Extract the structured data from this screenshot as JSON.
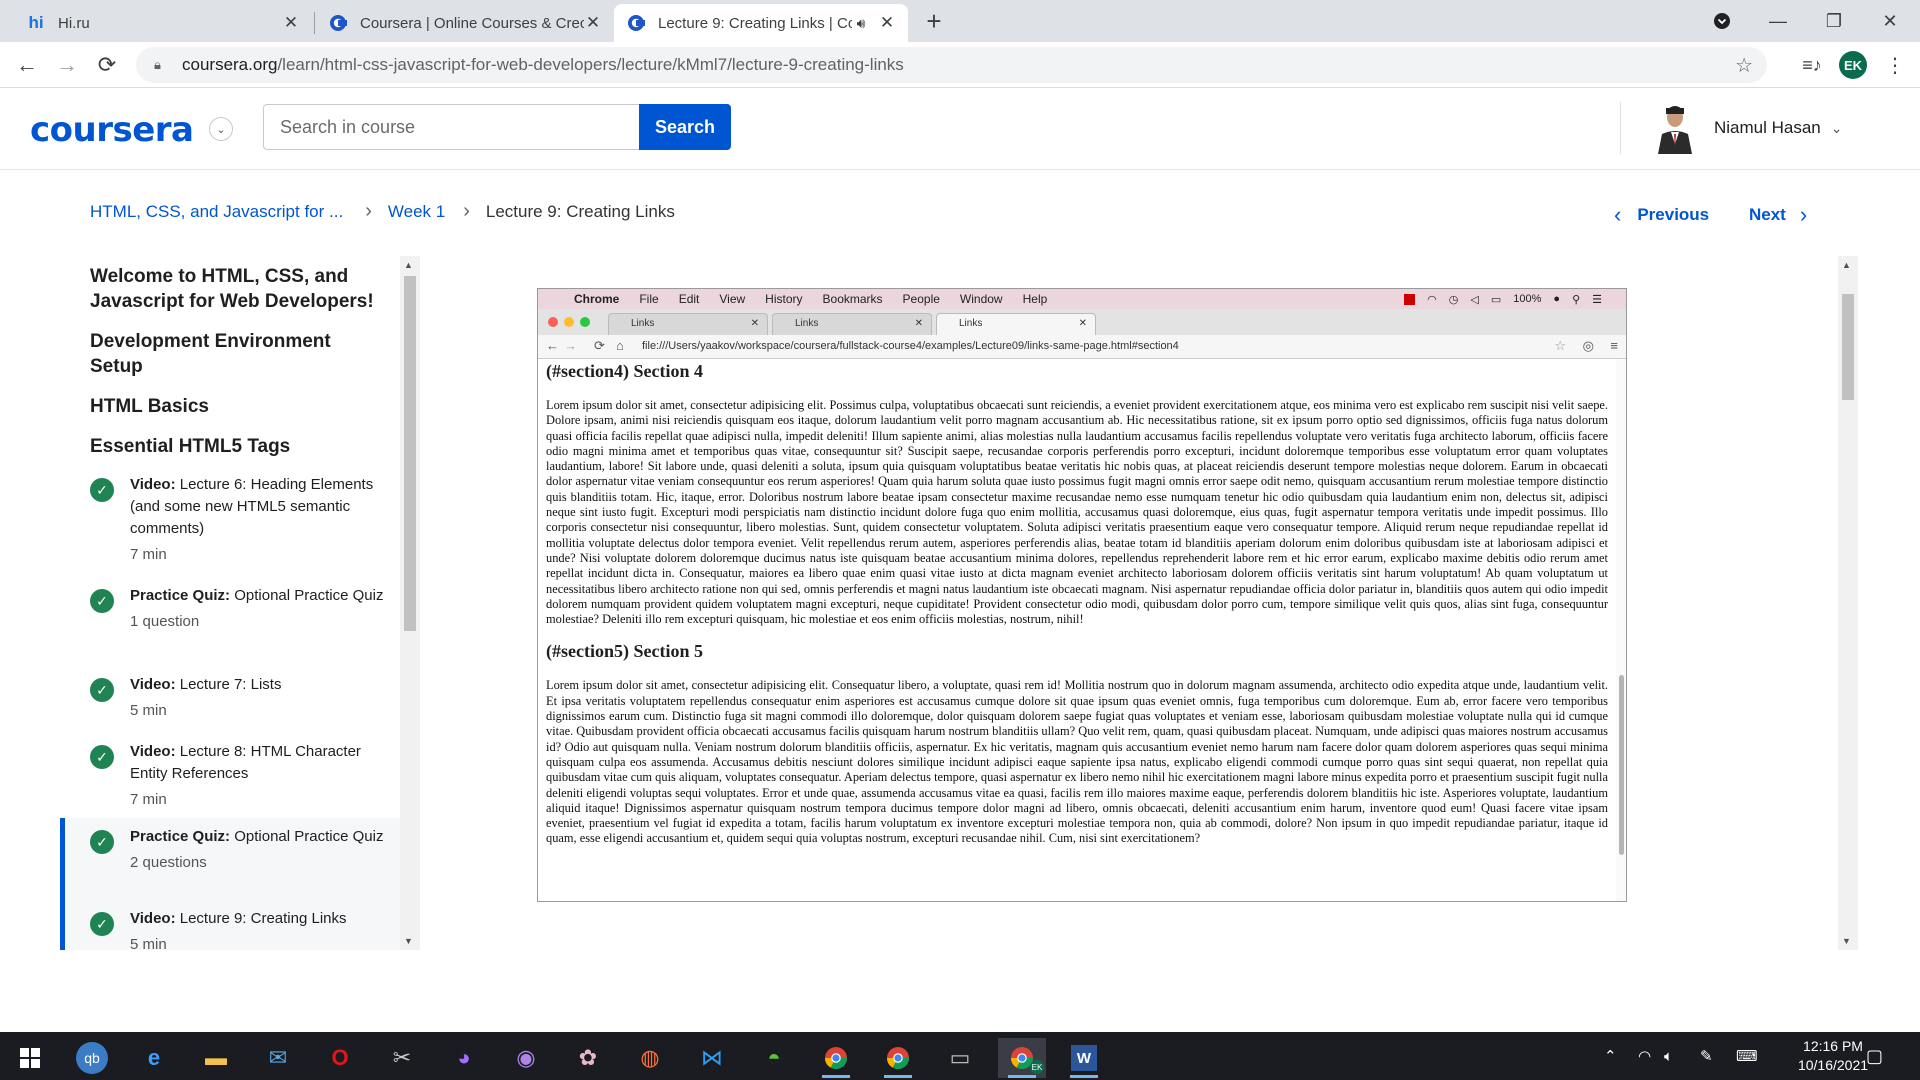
{
  "browser": {
    "tabs": [
      {
        "title": "Hi.ru",
        "icon": "hi-icon"
      },
      {
        "title": "Coursera | Online Courses & Crec",
        "icon": "coursera-icon"
      },
      {
        "title": "Lecture 9: Creating Links | Co",
        "icon": "coursera-icon"
      }
    ],
    "url_host": "coursera.org",
    "url_path": "/learn/html-css-javascript-for-web-developers/lecture/kMml7/lecture-9-creating-links",
    "profile_initials": "EK"
  },
  "header": {
    "logo": "coursera",
    "search_placeholder": "Search in course",
    "search_label": "Search",
    "user_name": "Niamul Hasan"
  },
  "breadcrumb": {
    "course": "HTML, CSS, and Javascript for ...",
    "week": "Week 1",
    "current": "Lecture 9: Creating Links"
  },
  "nav": {
    "previous": "Previous",
    "next": "Next"
  },
  "sidebar": {
    "sections": [
      "Welcome to HTML, CSS, and Javascript for Web Developers!",
      "Development Environment Setup",
      "HTML Basics",
      "Essential HTML5 Tags"
    ],
    "items": [
      {
        "type": "Video:",
        "title": "Lecture 6: Heading Elements (and some new HTML5 semantic comments)",
        "meta": "7 min"
      },
      {
        "type": "Practice Quiz:",
        "title": "Optional Practice Quiz",
        "meta": "1 question"
      },
      {
        "type": "Video:",
        "title": "Lecture 7: Lists",
        "meta": "5 min"
      },
      {
        "type": "Video:",
        "title": "Lecture 8: HTML Character Entity References",
        "meta": "7 min"
      },
      {
        "type": "Practice Quiz:",
        "title": "Optional Practice Quiz",
        "meta": "2 questions"
      },
      {
        "type": "Video:",
        "title": "Lecture 9: Creating Links",
        "meta": "5 min"
      }
    ]
  },
  "video": {
    "menubar": {
      "app": "Chrome",
      "items": [
        "File",
        "Edit",
        "View",
        "History",
        "Bookmarks",
        "People",
        "Window",
        "Help"
      ],
      "battery": "100%"
    },
    "tabs": [
      "Links",
      "Links",
      "Links"
    ],
    "url": "file:///Users/yaakov/workspace/coursera/fullstack-course4/examples/Lecture09/links-same-page.html#section4",
    "section4_heading": "(#section4) Section 4",
    "section4_text": "Lorem ipsum dolor sit amet, consectetur adipisicing elit. Possimus culpa, voluptatibus obcaecati sunt reiciendis, a eveniet provident exercitationem atque, eos minima vero est explicabo rem suscipit nisi velit saepe. Dolore ipsam, animi nisi reiciendis quisquam eos itaque, dolorum laudantium velit porro magnam accusantium ab. Hic necessitatibus ratione, sit ex ipsum porro optio sed dignissimos, officiis fuga natus dolorum quasi officia facilis repellat quae adipisci nulla, impedit deleniti! Illum sapiente animi, alias molestias nulla laudantium accusamus facilis repellendus voluptate vero veritatis fuga architecto laborum, officiis facere odio magni minima amet et temporibus quas vitae, consequuntur sit? Suscipit saepe, recusandae corporis perferendis porro excepturi, incidunt doloremque temporibus esse voluptatum error quam voluptates laudantium, labore! Sit labore unde, quasi deleniti a soluta, ipsum quia quisquam voluptatibus beatae veritatis hic nobis quas, at placeat reiciendis deserunt tempore molestias neque dolorem. Earum in obcaecati dolor aspernatur vitae veniam consequuntur eos rerum asperiores! Quam quia harum soluta quae iusto possimus fugit magni omnis error saepe odit nemo, quisquam accusantium rerum molestiae tempore distinctio quis blanditiis totam. Hic, itaque, error. Doloribus nostrum labore beatae ipsam consectetur maxime recusandae nemo esse numquam tenetur hic odio quibusdam quia laudantium enim non, delectus sit, adipisci neque sint iusto fugit. Excepturi modi perspiciatis nam distinctio incidunt dolore fuga quo enim mollitia, accusamus quasi doloremque, eius quas, fugit aspernatur tempora veritatis unde impedit possimus. Illo corporis consectetur nisi consequuntur, libero molestias. Sunt, quidem consectetur voluptatem. Soluta adipisci veritatis praesentium eaque vero consequatur tempore. Aliquid rerum neque repudiandae repellat id mollitia voluptate delectus dolor tempora eveniet. Velit repellendus rerum autem, asperiores perferendis alias, beatae totam id blanditiis aperiam dolorum enim doloribus quibusdam iste at laboriosam adipisci et unde? Nisi voluptate dolorem doloremque ducimus natus iste quisquam beatae accusantium minima dolores, repellendus reprehenderit labore rem et hic error earum, explicabo maxime debitis odio rerum amet repellat incidunt dicta in. Consequatur, maiores ea libero quae enim quasi vitae iusto at dicta magnam eveniet architecto laboriosam dolorem officiis veritatis sint harum voluptatum! Ab quam voluptatum ut necessitatibus libero architecto ratione non qui sed, omnis perferendis et magni natus laudantium iste obcaecati magnam. Nisi aspernatur repudiandae officia dolor pariatur in, blanditiis quos autem qui odio impedit dolorem numquam provident quidem voluptatem magni excepturi, neque cupiditate! Provident consectetur odio modi, quibusdam dolor porro cum, tempore similique velit quis quos, alias sint fuga, consequuntur molestiae? Deleniti illo rem excepturi quisquam, hic molestiae et eos enim officiis molestias, nostrum, nihil!",
    "section5_heading": "(#section5) Section 5",
    "section5_text": "Lorem ipsum dolor sit amet, consectetur adipisicing elit. Consequatur libero, a voluptate, quasi rem id! Mollitia nostrum quo in dolorum magnam assumenda, architecto odio expedita atque unde, laudantium velit. Et ipsa veritatis voluptatem repellendus consequatur enim asperiores est accusamus cumque dolore sit quae ipsum quas eveniet omnis, fuga temporibus cum doloremque. Eum ab, error facere vero temporibus dignissimos earum cum. Distinctio fuga sit magni commodi illo doloremque, dolor quisquam dolorem saepe fugiat quas voluptates et veniam esse, laboriosam quibusdam molestiae voluptate nulla qui id cumque vitae. Quibusdam provident officia obcaecati accusamus facilis quisquam harum nostrum blanditiis ullam? Quo velit rem, quam, quasi quibusdam placeat. Numquam, unde adipisci quas maiores nostrum accusamus id? Odio aut quisquam nulla. Veniam nostrum dolorum blanditiis officiis, aspernatur. Ex hic veritatis, magnam quis accusantium eveniet nemo harum nam facere dolor quam dolorem asperiores quas sequi minima quisquam culpa eos assumenda. Accusamus debitis nesciunt dolores similique incidunt adipisci eaque sapiente ipsa natus, explicabo eligendi commodi cumque porro quas sint sequi quaerat, non repellat quia quibusdam vitae cum quis aliquam, voluptates consequatur. Aperiam delectus tempore, quasi aspernatur ex libero nemo nihil hic exercitationem magni labore minus expedita porro et praesentium suscipit fugit nulla deleniti eligendi voluptas sequi voluptates. Error et unde quae, assumenda accusamus vitae ea quasi, facilis rem illo maiores maxime eaque, perferendis dolorem blanditiis hic iste. Asperiores voluptate, laudantium aliquid itaque! Dignissimos aspernatur quisquam nostrum tempora ducimus tempore dolor magni ad libero, omnis obcaecati, deleniti accusantium enim harum, inventore quod eum! Quasi facere vitae ipsam eveniet, praesentium vel fugiat id expedita a totam, facilis harum voluptatum ex inventore excepturi molestiae tempora non, quia ab commodi, dolore? Non ipsum in quo impedit repudiandae pariatur, itaque id quam, esse eligendi accusantium et, quidem sequi quia voluptas nostrum, excepturi recusandae nihil. Cum, nisi sint exercitationem?"
  },
  "taskbar": {
    "time": "12:16 PM",
    "date": "10/16/2021",
    "word_label": "W",
    "chrome_user": "EK"
  },
  "colors": {
    "brand": "#0056d2",
    "check": "#1f8354",
    "taskbar": "#1a1c22"
  }
}
